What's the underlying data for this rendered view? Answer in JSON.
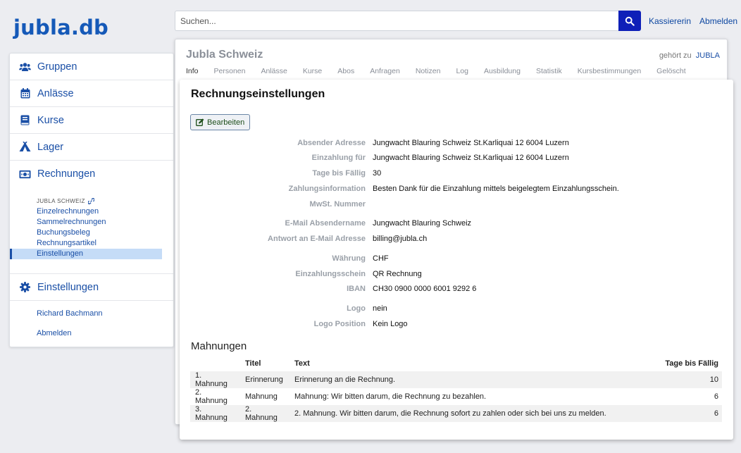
{
  "app": {
    "logo": "jubla.db"
  },
  "search": {
    "placeholder": "Suchen..."
  },
  "top_links": {
    "role": "Kassiererin",
    "logout": "Abmelden"
  },
  "sidebar": {
    "items": [
      {
        "label": "Gruppen",
        "icon": "users-icon"
      },
      {
        "label": "Anlässe",
        "icon": "calendar-icon"
      },
      {
        "label": "Kurse",
        "icon": "book-icon"
      },
      {
        "label": "Lager",
        "icon": "tent-icon"
      },
      {
        "label": "Rechnungen",
        "icon": "money-bill-icon"
      }
    ],
    "sub_title": "JUBLA SCHWEIZ",
    "sub_links": [
      "Einzelrechnungen",
      "Sammelrechnungen",
      "Buchungsbeleg",
      "Rechnungsartikel",
      "Einstellungen"
    ],
    "settings_label": "Einstellungen",
    "user_name": "Richard Bachmann",
    "logout": "Abmelden"
  },
  "group": {
    "title": "Jubla Schweiz",
    "belongs_prefix": "gehört zu",
    "belongs_link": "JUBLA",
    "tabs": [
      "Info",
      "Personen",
      "Anlässe",
      "Kurse",
      "Abos",
      "Anfragen",
      "Notizen",
      "Log",
      "Ausbildung",
      "Statistik",
      "Kursbestimmungen",
      "Gelöscht"
    ]
  },
  "settings": {
    "title": "Rechnungseinstellungen",
    "edit_label": "Bearbeiten",
    "fields": [
      {
        "label": "Absender Adresse",
        "value": "Jungwacht Blauring Schweiz St.Karliquai 12 6004 Luzern"
      },
      {
        "label": "Einzahlung für",
        "value": "Jungwacht Blauring Schweiz St.Karliquai 12 6004 Luzern"
      },
      {
        "label": "Tage bis Fällig",
        "value": "30"
      },
      {
        "label": "Zahlungsinformation",
        "value": "Besten Dank für die Einzahlung mittels beigelegtem Einzahlungsschein."
      },
      {
        "label": "MwSt. Nummer",
        "value": ""
      },
      {
        "label": "E-Mail Absendername",
        "value": "Jungwacht Blauring Schweiz"
      },
      {
        "label": "Antwort an E-Mail Adresse",
        "value": "billing@jubla.ch"
      },
      {
        "label": "Währung",
        "value": "CHF"
      },
      {
        "label": "Einzahlungsschein",
        "value": "QR Rechnung"
      },
      {
        "label": "IBAN",
        "value": "CH30 0900 0000 6001 9292 6"
      },
      {
        "label": "Logo",
        "value": "nein"
      },
      {
        "label": "Logo Position",
        "value": "Kein Logo"
      }
    ]
  },
  "reminders": {
    "title": "Mahnungen",
    "headers": [
      "",
      "Titel",
      "Text",
      "Tage bis Fällig"
    ],
    "rows": [
      [
        "1. Mahnung",
        "Erinnerung",
        "Erinnerung an die Rechnung.",
        "10"
      ],
      [
        "2. Mahnung",
        "Mahnung",
        "Mahnung: Wir bitten darum, die Rechnung zu bezahlen.",
        "6"
      ],
      [
        "3. Mahnung",
        "2. Mahnung",
        "2. Mahnung. Wir bitten darum, die Rechnung sofort zu zahlen oder sich bei uns zu melden.",
        "6"
      ]
    ]
  },
  "colors": {
    "brand": "#1559b8",
    "search_button": "#0e1fb8",
    "active_bg": "#c5dcf7"
  }
}
